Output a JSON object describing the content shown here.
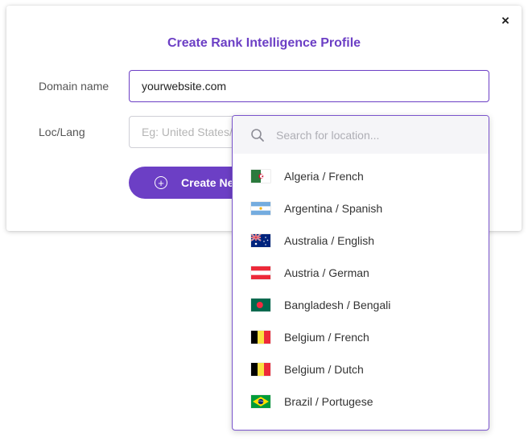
{
  "modal": {
    "title": "Create Rank Intelligence Profile",
    "close_label": "×",
    "domain_label": "Domain name",
    "domain_value": "yourwebsite.com",
    "loc_label": "Loc/Lang",
    "loc_placeholder": "Eg: United States/English",
    "create_label": "Create New"
  },
  "dropdown": {
    "search_placeholder": "Search for location...",
    "options": [
      {
        "label": "Algeria / French",
        "flag": "algeria-flag-icon"
      },
      {
        "label": "Argentina / Spanish",
        "flag": "argentina-flag-icon"
      },
      {
        "label": "Australia / English",
        "flag": "australia-flag-icon"
      },
      {
        "label": "Austria / German",
        "flag": "austria-flag-icon"
      },
      {
        "label": "Bangladesh / Bengali",
        "flag": "bangladesh-flag-icon"
      },
      {
        "label": "Belgium / French",
        "flag": "belgium-flag-icon"
      },
      {
        "label": "Belgium / Dutch",
        "flag": "belgium-flag-icon"
      },
      {
        "label": "Brazil / Portugese",
        "flag": "brazil-flag-icon"
      }
    ]
  },
  "colors": {
    "accent": "#6c3fc5",
    "label": "#555555",
    "search_bg": "#f5f5f8"
  }
}
